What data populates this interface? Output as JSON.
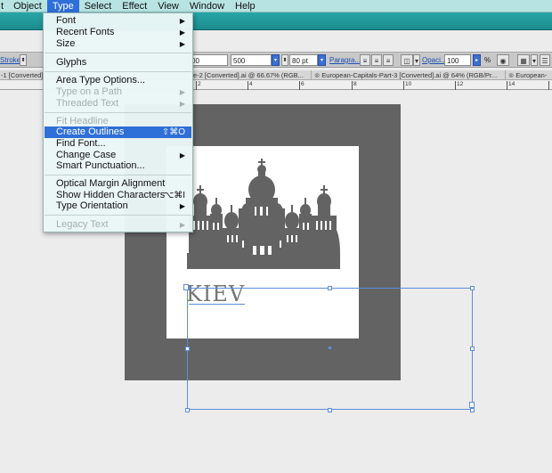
{
  "menubar": {
    "items": [
      "t",
      "Object",
      "Type",
      "Select",
      "Effect",
      "View",
      "Window",
      "Help"
    ],
    "active": "Type"
  },
  "control_bar": {
    "stroke_label": "Stroke:",
    "field1": "00",
    "field2": "500",
    "size_value": "80 pt",
    "paragraph_label": "Paragra...",
    "opacity_label": "Opaci...",
    "opacity_value": "100",
    "percent": "%"
  },
  "tabs": [
    "-1 [Converted]",
    "e-2 [Converted].ai @ 66.67% (RGB...",
    "European-Capitals-Part-3 [Converted].ai @ 64% (RGB/Pr...",
    "European-"
  ],
  "ruler": {
    "labels": [
      "2",
      "4",
      "6",
      "8",
      "10",
      "12",
      "14",
      "16"
    ]
  },
  "artboard": {
    "text": "KIEV"
  },
  "type_menu": {
    "font": "Font",
    "recent_fonts": "Recent Fonts",
    "size": "Size",
    "glyphs": "Glyphs",
    "area_type_options": "Area Type Options...",
    "type_on_a_path": "Type on a Path",
    "threaded_text": "Threaded Text",
    "fit_headline": "Fit Headline",
    "create_outlines": "Create Outlines",
    "create_outlines_shortcut": "⇧⌘O",
    "find_font": "Find Font...",
    "change_case": "Change Case",
    "smart_punctuation": "Smart Punctuation...",
    "optical_margin_alignment": "Optical Margin Alignment",
    "show_hidden_characters": "Show Hidden Characters",
    "show_hidden_characters_shortcut": "⌥⌘I",
    "type_orientation": "Type Orientation",
    "legacy_text": "Legacy Text"
  },
  "icons": [
    "chevron-right-icon",
    "selection-handle-icon",
    "spinner-arrow-icon"
  ],
  "colors": {
    "menu_highlight": "#2e6fd8",
    "title_bar": "#1c8b8d",
    "frame_gray": "#636363",
    "selection_blue": "#5b8edc"
  }
}
